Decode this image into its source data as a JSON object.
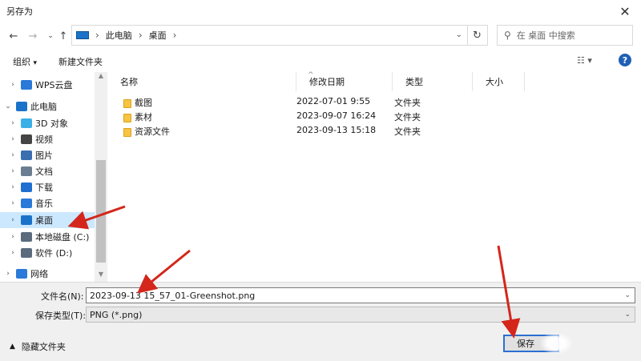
{
  "window": {
    "title": "另存为"
  },
  "navigation": {
    "back_icon": "back-arrow",
    "forward_icon": "forward-arrow",
    "history_icon": "chevron-down",
    "up_icon": "up-arrow",
    "breadcrumbs": [
      "此电脑",
      "桌面"
    ],
    "refresh_icon": "refresh",
    "search_placeholder": "在 桌面 中搜索"
  },
  "toolbar": {
    "organize_label": "组织",
    "organize_caret": "▾",
    "new_folder_label": "新建文件夹",
    "help_label": "?"
  },
  "sidebar": {
    "items": [
      {
        "label": "WPS云盘",
        "icon": "cloud-icon",
        "expanded": false,
        "color": "#2b79d8"
      },
      {
        "label": "此电脑",
        "icon": "computer-icon",
        "expanded": true,
        "color": "#1a73c9"
      },
      {
        "label": "3D 对象",
        "icon": "cube-icon",
        "expanded": false,
        "color": "#3bb0e6"
      },
      {
        "label": "视频",
        "icon": "video-icon",
        "expanded": false,
        "color": "#444444"
      },
      {
        "label": "图片",
        "icon": "pictures-icon",
        "expanded": false,
        "color": "#3a6fb0"
      },
      {
        "label": "文档",
        "icon": "documents-icon",
        "expanded": false,
        "color": "#6b7d91"
      },
      {
        "label": "下载",
        "icon": "download-icon",
        "expanded": false,
        "color": "#1f6fd0"
      },
      {
        "label": "音乐",
        "icon": "music-icon",
        "expanded": false,
        "color": "#2b79d8"
      },
      {
        "label": "桌面",
        "icon": "desktop-icon",
        "expanded": false,
        "selected": true,
        "color": "#1a73c9"
      },
      {
        "label": "本地磁盘 (C:)",
        "icon": "drive-c-icon",
        "expanded": false,
        "color": "#5a6b7d"
      },
      {
        "label": "软件 (D:)",
        "icon": "drive-d-icon",
        "expanded": false,
        "color": "#5a6b7d"
      },
      {
        "label": "网络",
        "icon": "network-icon",
        "expanded": false,
        "color": "#2b79d8"
      }
    ]
  },
  "file_list": {
    "columns": [
      "名称",
      "修改日期",
      "类型",
      "大小"
    ],
    "rows": [
      {
        "name": "截图",
        "modified": "2022-07-01 9:55",
        "type": "文件夹",
        "size": ""
      },
      {
        "name": "素材",
        "modified": "2023-09-07 16:24",
        "type": "文件夹",
        "size": ""
      },
      {
        "name": "资源文件",
        "modified": "2023-09-13 15:18",
        "type": "文件夹",
        "size": ""
      }
    ]
  },
  "form": {
    "filename_label": "文件名(N):",
    "filename_value": "2023-09-13 15_57_01-Greenshot.png",
    "filetype_label": "保存类型(T):",
    "filetype_value": "PNG (*.png)"
  },
  "footer": {
    "hide_folders_label": "隐藏文件夹",
    "save_label": "保存"
  },
  "colors": {
    "selection": "#cce8ff",
    "accent": "#2b6fd0",
    "annotation_arrow": "#d4261b"
  }
}
